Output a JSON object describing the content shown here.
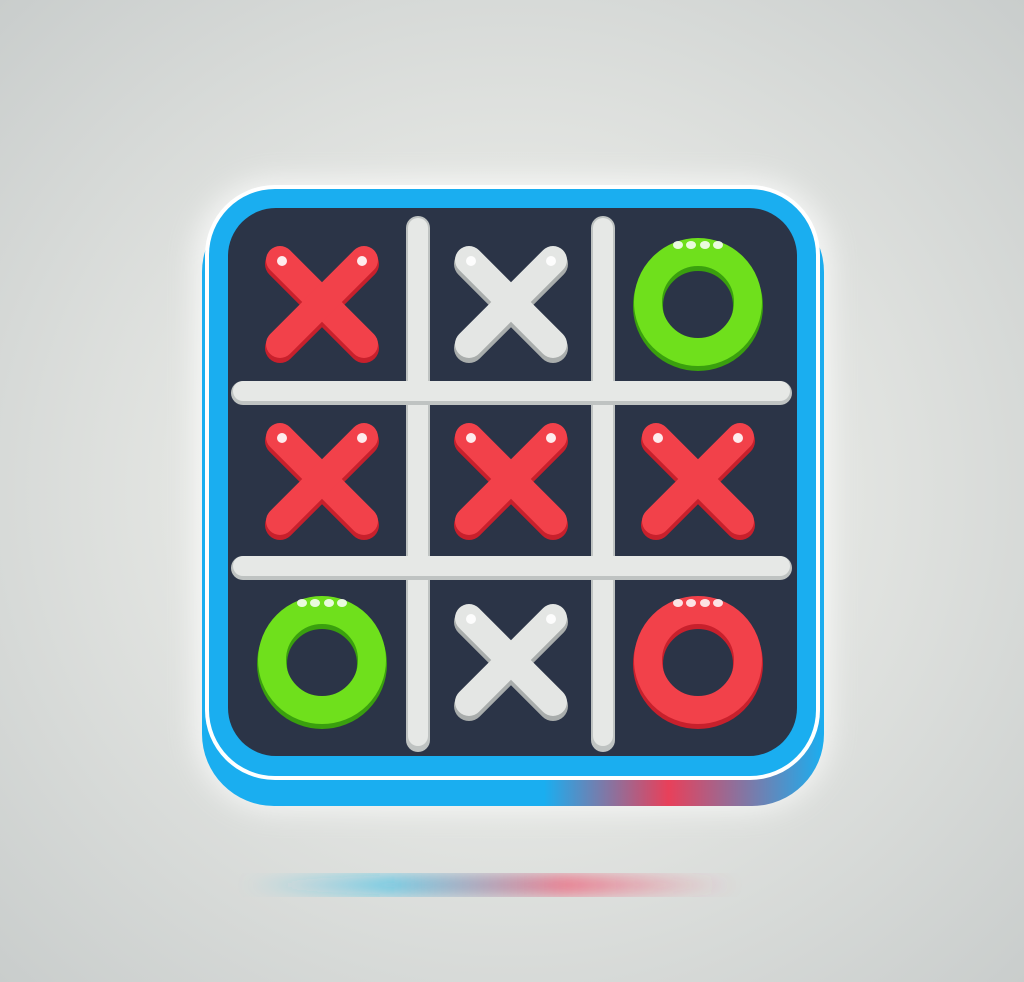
{
  "game": "tic-tac-toe",
  "colors": {
    "frame": "#1aaef0",
    "board": "#2b3447",
    "grid": "#e6e8e6",
    "red": "#f2414a",
    "green": "#6fe01c",
    "white": "#e4e6e4"
  },
  "board": [
    [
      {
        "mark": "X",
        "color": "red"
      },
      {
        "mark": "X",
        "color": "white"
      },
      {
        "mark": "O",
        "color": "green"
      }
    ],
    [
      {
        "mark": "X",
        "color": "red"
      },
      {
        "mark": "X",
        "color": "red"
      },
      {
        "mark": "X",
        "color": "red"
      }
    ],
    [
      {
        "mark": "O",
        "color": "green"
      },
      {
        "mark": "X",
        "color": "white"
      },
      {
        "mark": "O",
        "color": "red"
      }
    ]
  ]
}
